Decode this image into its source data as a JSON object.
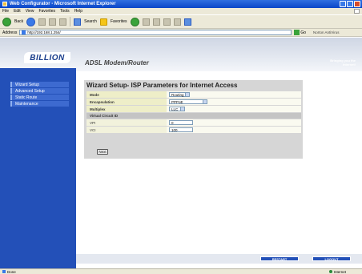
{
  "window": {
    "title": "Web Configurator - Microsoft Internet Explorer"
  },
  "menu": [
    "File",
    "Edit",
    "View",
    "Favorites",
    "Tools",
    "Help"
  ],
  "toolbar": {
    "back_label": "Back",
    "search_label": "Search",
    "favorites_label": "Favorites"
  },
  "address": {
    "label": "Address",
    "url": "http://192.168.1.254/",
    "go_label": "Go",
    "links_label": "Norton AntiVirus"
  },
  "header": {
    "logo": "BILLION",
    "product": "ADSL Modem/Router",
    "tagline_line1": "Bringing you the",
    "tagline_line2": "Internet!"
  },
  "sidebar": {
    "items": [
      "Wizard Setup",
      "Advanced Setup",
      "Static Route",
      "Maintenance"
    ]
  },
  "wizard": {
    "title": "Wizard Setup- ISP Parameters for Internet Access",
    "mode_label": "Mode",
    "mode_value": "Routing",
    "encapsulation_label": "Encapsulation",
    "encapsulation_value": "PPPoE",
    "multiplex_label": "Multiplex",
    "multiplex_value": "LLC",
    "vc_section": "Virtual Circuit ID",
    "vpi_label": "VPI",
    "vpi_value": "0",
    "vci_label": "VCI",
    "vci_value": "100",
    "next_label": "Next"
  },
  "footer": {
    "restart_label": "RESTART",
    "logout_label": "LOGOUT"
  },
  "status": {
    "left": "Done",
    "zone": "Internet"
  }
}
